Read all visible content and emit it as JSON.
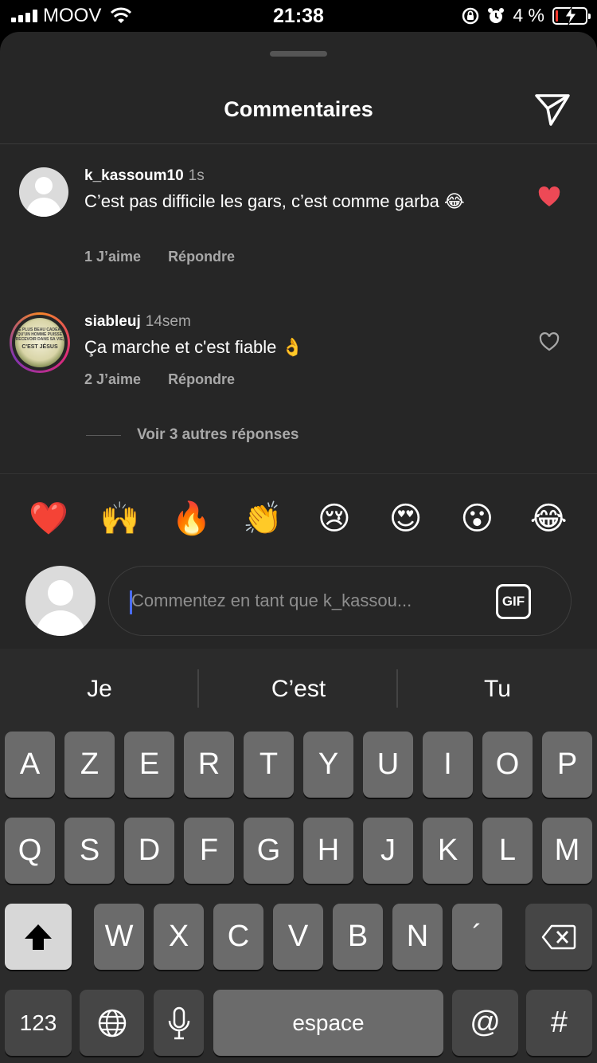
{
  "status_bar": {
    "carrier": "MOOV",
    "time": "21:38",
    "battery_percent": "4 %",
    "battery_level": 0.04,
    "battery_color": "#ff3b30"
  },
  "sheet": {
    "title": "Commentaires",
    "share_icon": "send-icon"
  },
  "comments": [
    {
      "username": "k_kassoum10",
      "time": "1s",
      "text": "C’est pas difficile les gars, c’est comme garba 😂",
      "likes_label": "1 J’aime",
      "reply_label": "Répondre",
      "liked": true,
      "heart_color": "#ed4956"
    },
    {
      "username": "siableuj",
      "time": "14sem",
      "text": "Ça marche et c'est fiable 👌",
      "likes_label": "2 J’aime",
      "reply_label": "Répondre",
      "liked": false,
      "avatar_text_small": "LE PLUS BEAU CADEAU QU'UN HOMME PUISSE RECEVOIR DANS SA VIE,",
      "avatar_text_big": "C'EST JÉSUS"
    }
  ],
  "view_replies": "Voir 3 autres réponses",
  "emojis": [
    "❤️",
    "🙌",
    "🔥",
    "👏",
    "😢",
    "😍",
    "😮",
    "😂"
  ],
  "input": {
    "placeholder": "Commentez en tant que k_kassou...",
    "gif_label": "GIF"
  },
  "keyboard": {
    "suggestions": [
      "Je",
      "C’est",
      "Tu"
    ],
    "row1": [
      "A",
      "Z",
      "E",
      "R",
      "T",
      "Y",
      "U",
      "I",
      "O",
      "P"
    ],
    "row2": [
      "Q",
      "S",
      "D",
      "F",
      "G",
      "H",
      "J",
      "K",
      "L",
      "M"
    ],
    "row3": [
      "W",
      "X",
      "C",
      "V",
      "B",
      "N",
      "´"
    ],
    "numbers_label": "123",
    "space_label": "espace",
    "at_label": "@",
    "hash_label": "#"
  }
}
